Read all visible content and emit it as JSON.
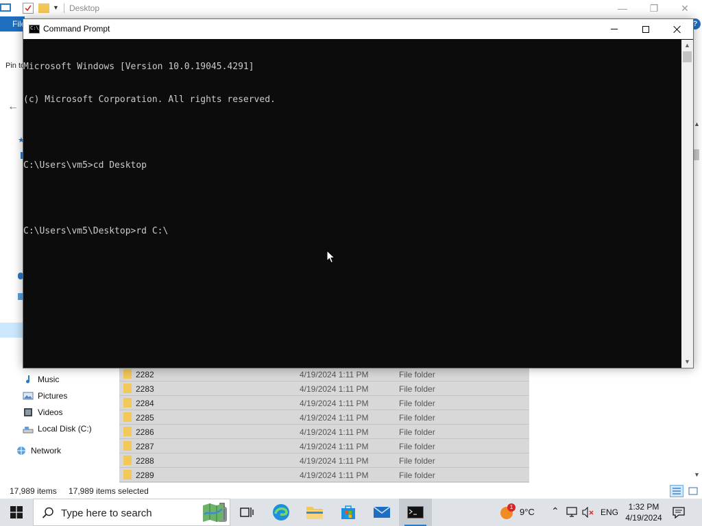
{
  "explorer": {
    "title": "Desktop",
    "ribbon_file_label": "File",
    "pin_text": "Pin to",
    "help_label": "?",
    "nav": [
      {
        "label": "Music",
        "icon": "music-icon"
      },
      {
        "label": "Pictures",
        "icon": "pictures-icon"
      },
      {
        "label": "Videos",
        "icon": "videos-icon"
      },
      {
        "label": "Local Disk (C:)",
        "icon": "drive-icon"
      },
      {
        "label": "Network",
        "icon": "network-icon"
      }
    ],
    "files": [
      {
        "name": "2282",
        "date": "4/19/2024 1:11 PM",
        "type": "File folder"
      },
      {
        "name": "2283",
        "date": "4/19/2024 1:11 PM",
        "type": "File folder"
      },
      {
        "name": "2284",
        "date": "4/19/2024 1:11 PM",
        "type": "File folder"
      },
      {
        "name": "2285",
        "date": "4/19/2024 1:11 PM",
        "type": "File folder"
      },
      {
        "name": "2286",
        "date": "4/19/2024 1:11 PM",
        "type": "File folder"
      },
      {
        "name": "2287",
        "date": "4/19/2024 1:11 PM",
        "type": "File folder"
      },
      {
        "name": "2288",
        "date": "4/19/2024 1:11 PM",
        "type": "File folder"
      },
      {
        "name": "2289",
        "date": "4/19/2024 1:11 PM",
        "type": "File folder"
      }
    ],
    "status": {
      "count": "17,989 items",
      "selected": "17,989 items selected"
    }
  },
  "cmd": {
    "title": "Command Prompt",
    "icon_text": "C:\\_",
    "lines": [
      "Microsoft Windows [Version 10.0.19045.4291]",
      "(c) Microsoft Corporation. All rights reserved.",
      "",
      "C:\\Users\\vm5>cd Desktop",
      "",
      "C:\\Users\\vm5\\Desktop>rd C:\\"
    ]
  },
  "taskbar": {
    "search_placeholder": "Type here to search",
    "apps": [
      "luggage-icon",
      "maps-icon",
      "task-view-icon",
      "edge-icon",
      "file-explorer-icon",
      "store-icon",
      "mail-icon",
      "command-prompt-icon"
    ],
    "weather_badge": "1",
    "weather_temp": "9°C",
    "language": "ENG",
    "time": "1:32 PM",
    "date": "4/19/2024"
  },
  "colors": {
    "console_bg": "#0c0c0c",
    "console_text": "#cccccc",
    "accent": "#1f6fc0",
    "taskbar": "#dfe3e8",
    "folder": "#f3c85a"
  }
}
